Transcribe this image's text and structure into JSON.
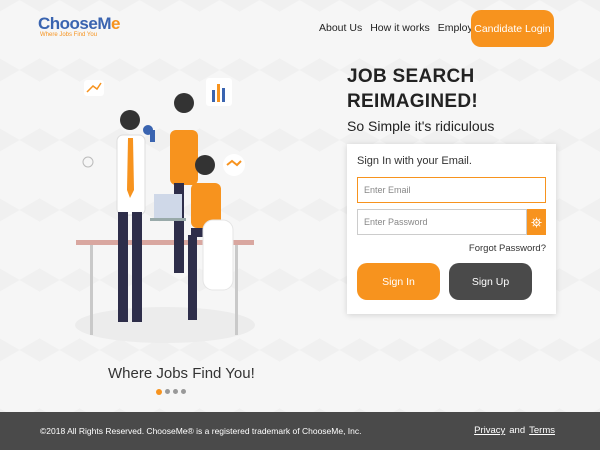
{
  "header": {
    "logo_main_blue": "ChooseM",
    "logo_main_orange": "e",
    "logo_tagline": "Where Jobs Find You",
    "nav": [
      "About Us",
      "How it works",
      "Employers"
    ],
    "candidate_login": "Candidate Login"
  },
  "hero": {
    "title_line1": "JOB SEARCH",
    "title_line2": "REIMAGINED!",
    "subtitle": "So Simple it's ridiculous"
  },
  "signin": {
    "title": "Sign In with your Email.",
    "email_placeholder": "Enter Email",
    "password_placeholder": "Enter Password",
    "forgot": "Forgot Password?",
    "signin_label": "Sign In",
    "signup_label": "Sign Up"
  },
  "illustration": {
    "tagline": "Where Jobs Find You!",
    "carousel_active_index": 0,
    "carousel_count": 4
  },
  "footer": {
    "copyright": "©2018 All Rights Reserved. ChooseMe® is a registered trademark of ChooseMe, Inc.",
    "privacy": "Privacy",
    "and": "and",
    "terms": "Terms"
  },
  "colors": {
    "accent": "#f7931e",
    "brand_blue": "#3a64b0",
    "dark": "#4a4a4a"
  }
}
